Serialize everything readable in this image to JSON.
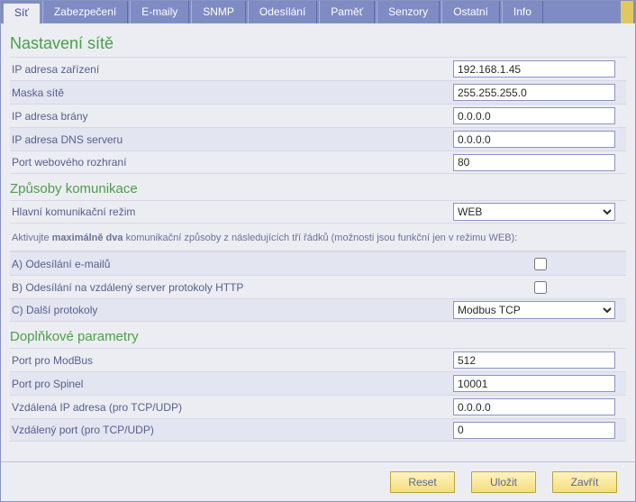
{
  "tabs": {
    "t0": "Síť",
    "t1": "Zabezpečení",
    "t2": "E-maily",
    "t3": "SNMP",
    "t4": "Odesílání",
    "t5": "Paměť",
    "t6": "Senzory",
    "t7": "Ostatní",
    "t8": "Info"
  },
  "sections": {
    "net_title": "Nastavení sítě",
    "comm_title": "Způsoby komunikace",
    "extra_title": "Doplňkové parametry"
  },
  "net": {
    "ip_label": "IP adresa zařízení",
    "ip_value": "192.168.1.45",
    "mask_label": "Maska sítě",
    "mask_value": "255.255.255.0",
    "gw_label": "IP adresa brány",
    "gw_value": "0.0.0.0",
    "dns_label": "IP adresa DNS serveru",
    "dns_value": "0.0.0.0",
    "web_port_label": "Port webového rozhraní",
    "web_port_value": "80"
  },
  "comm": {
    "mode_label": "Hlavní komunikační režim",
    "mode_value": "WEB",
    "hint_pre": "Aktivujte ",
    "hint_bold": "maximálně dva",
    "hint_post": " komunikační způsoby z následujících tří řádků (možnosti jsou funkční jen v režimu WEB):",
    "a_label": "A) Odesílání e-mailů",
    "b_label": "B) Odesílání na vzdálený server protokoly HTTP",
    "c_label": "C) Další protokoly",
    "c_value": "Modbus TCP"
  },
  "extra": {
    "modbus_port_label": "Port pro ModBus",
    "modbus_port_value": "512",
    "spinel_port_label": "Port pro Spinel",
    "spinel_port_value": "10001",
    "remote_ip_label": "Vzdálená IP adresa (pro TCP/UDP)",
    "remote_ip_value": "0.0.0.0",
    "remote_port_label": "Vzdálený port (pro TCP/UDP)",
    "remote_port_value": "0"
  },
  "buttons": {
    "reset": "Reset",
    "save": "Uložit",
    "close": "Zavřít"
  }
}
